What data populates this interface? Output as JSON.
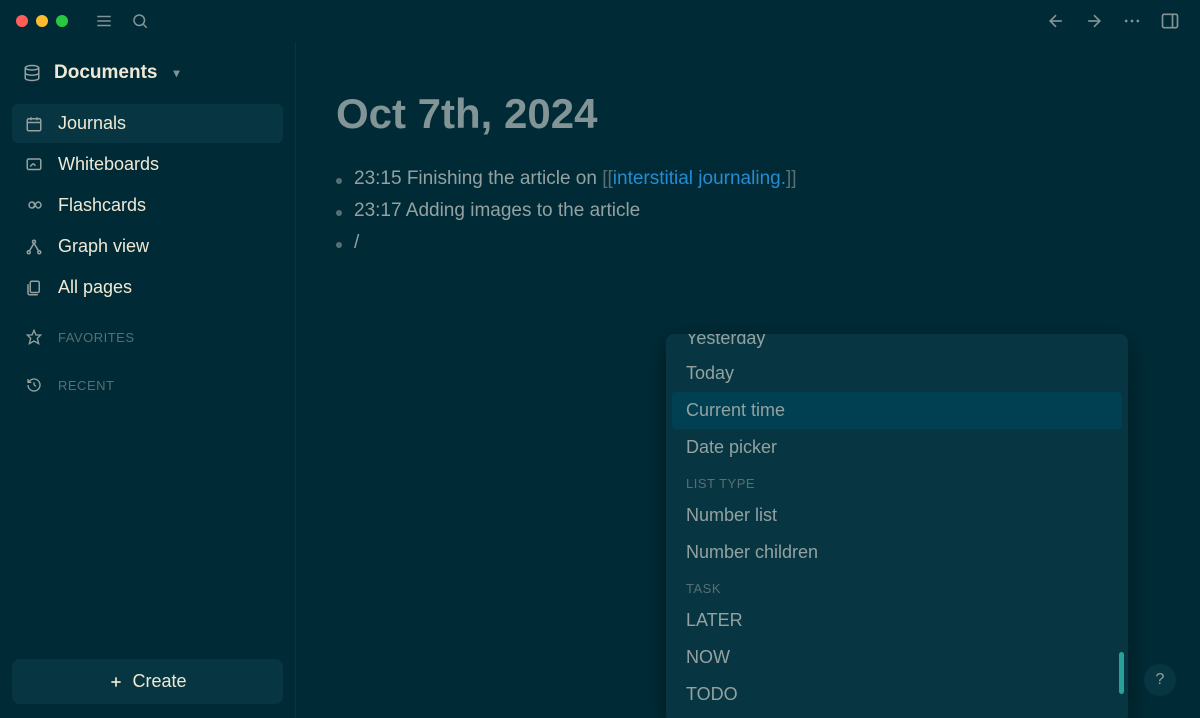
{
  "sidebar": {
    "documents_label": "Documents",
    "nav": [
      {
        "label": "Journals",
        "icon": "calendar-icon",
        "active": true
      },
      {
        "label": "Whiteboards",
        "icon": "whiteboard-icon",
        "active": false
      },
      {
        "label": "Flashcards",
        "icon": "infinity-icon",
        "active": false
      },
      {
        "label": "Graph view",
        "icon": "graph-icon",
        "active": false
      },
      {
        "label": "All pages",
        "icon": "pages-icon",
        "active": false
      }
    ],
    "favorites_label": "FAVORITES",
    "recent_label": "RECENT",
    "create_label": "Create"
  },
  "page": {
    "title": "Oct 7th, 2024",
    "bullets": [
      {
        "time": "23:15",
        "text": "Finishing the article on ",
        "link": "interstitial journaling."
      },
      {
        "time": "23:17",
        "text": "Adding images to the article",
        "link": null
      },
      {
        "time": "",
        "text": "/",
        "link": null
      }
    ]
  },
  "slash_menu": {
    "cutoff_item": "Yesterday",
    "group1": [
      {
        "label": "Today",
        "selected": false
      },
      {
        "label": "Current time",
        "selected": true
      },
      {
        "label": "Date picker",
        "selected": false
      }
    ],
    "header1": "LIST TYPE",
    "group2": [
      {
        "label": "Number list"
      },
      {
        "label": "Number children"
      }
    ],
    "header2": "TASK",
    "group3": [
      {
        "label": "LATER"
      },
      {
        "label": "NOW"
      },
      {
        "label": "TODO"
      }
    ]
  },
  "help_label": "?"
}
